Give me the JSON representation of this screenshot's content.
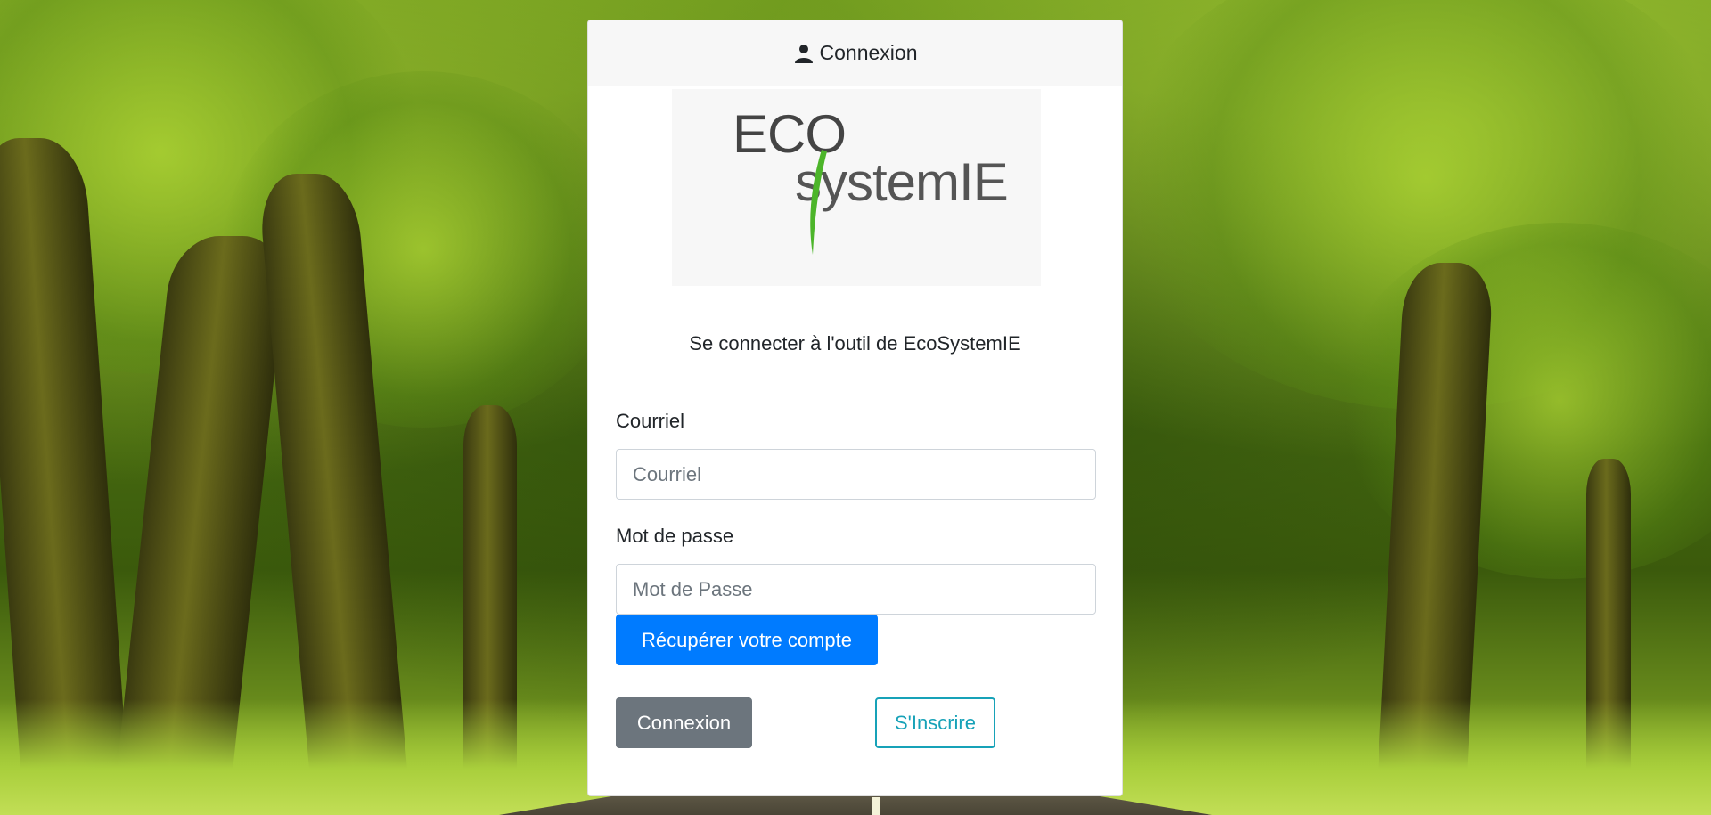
{
  "header": {
    "title": "Connexion",
    "icon": "user-icon"
  },
  "logo": {
    "line1": "ECO",
    "line2": "systemIE",
    "accent_color": "#4cb52a"
  },
  "subtitle": "Se connecter à l'outil de EcoSystemIE",
  "form": {
    "email_label": "Courriel",
    "email_placeholder": "Courriel",
    "email_value": "",
    "password_label": "Mot de passe",
    "password_placeholder": "Mot de Passe",
    "password_value": ""
  },
  "buttons": {
    "recover": "Récupérer votre compte",
    "login": "Connexion",
    "register": "S'Inscrire"
  },
  "colors": {
    "primary": "#007bff",
    "secondary": "#6c757d",
    "info": "#17a2b8"
  }
}
